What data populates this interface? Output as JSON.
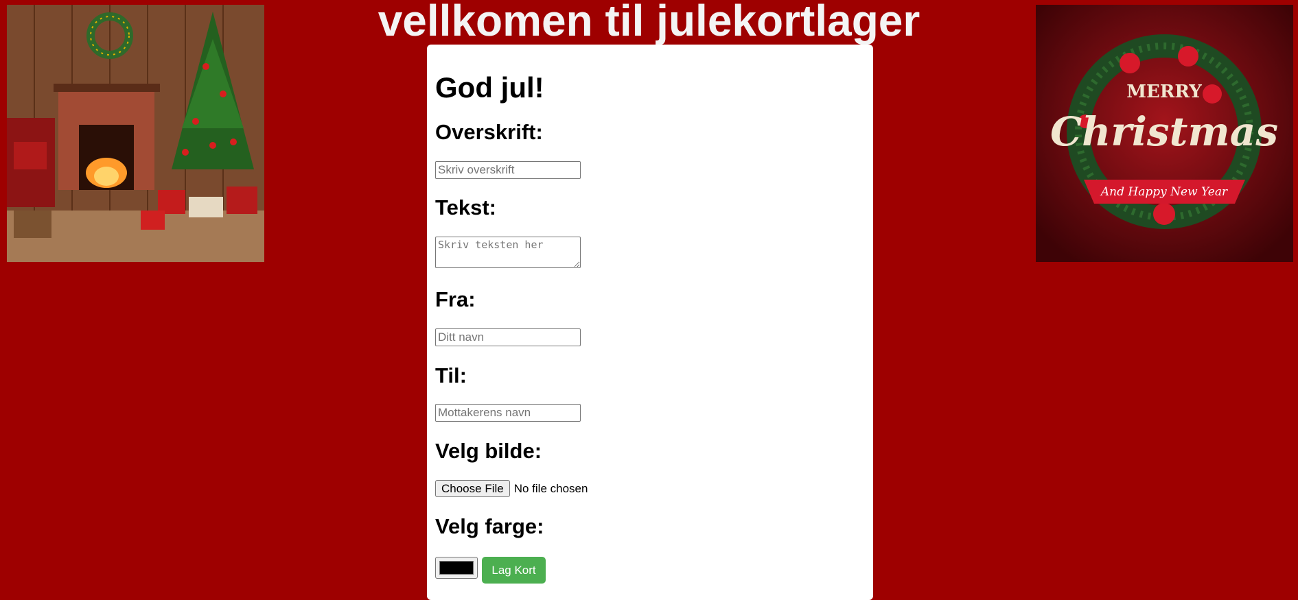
{
  "page": {
    "title": "vellkomen til julekortlager"
  },
  "card": {
    "heading": "God jul!",
    "fields": {
      "overskrift": {
        "label": "Overskrift:",
        "placeholder": "Skriv overskrift",
        "value": ""
      },
      "tekst": {
        "label": "Tekst:",
        "placeholder": "Skriv teksten her",
        "value": ""
      },
      "fra": {
        "label": "Fra:",
        "placeholder": "Ditt navn",
        "value": ""
      },
      "til": {
        "label": "Til:",
        "placeholder": "Mottakerens navn",
        "value": ""
      }
    },
    "image": {
      "label": "Velg bilde:",
      "button_label": "Choose File",
      "status": "No file chosen"
    },
    "color": {
      "label": "Velg farge:",
      "value": "#000000"
    },
    "submit_label": "Lag Kort"
  },
  "images": {
    "left": {
      "description": "christmas-fireplace-tree-photo"
    },
    "right": {
      "description": "merry-christmas-wreath-card",
      "text_line1": "MERRY",
      "text_line2": "Christmas",
      "text_line3": "And Happy New Year"
    }
  },
  "colors": {
    "background": "#9e0000",
    "card": "#ffffff",
    "accent": "#4caf50",
    "title_text": "#f4f4f4"
  }
}
